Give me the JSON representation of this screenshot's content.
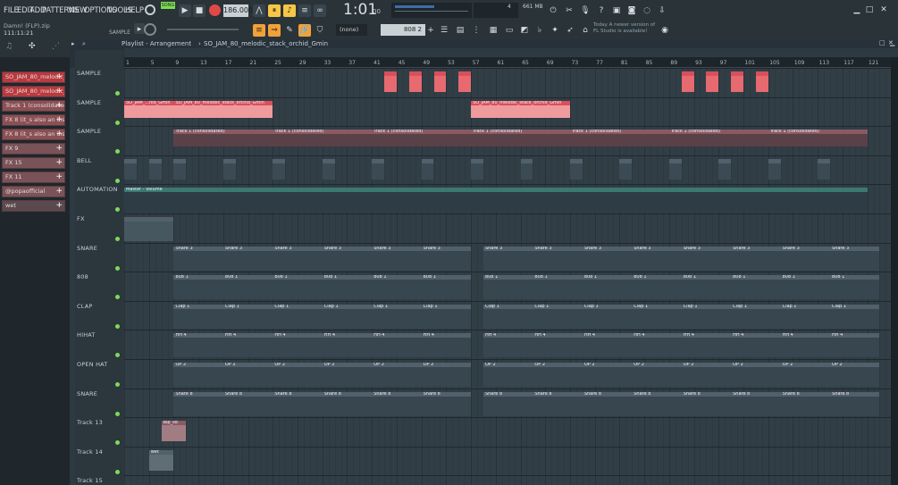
{
  "menu": {
    "items": [
      "FILE",
      "EDIT",
      "ADD",
      "PATTERNS",
      "VIEW",
      "OPTIONS",
      "TOOLS",
      "HELP"
    ]
  },
  "transport": {
    "song_label": "SONG",
    "tempo": "186.000",
    "time": "1:01",
    "time_sub": "00",
    "mem": "661 MB",
    "cpu": "4"
  },
  "project": {
    "name": "Damn! (FLP).zip",
    "time": "111:11:21",
    "sample_label": "SAMPLE"
  },
  "toolbar": {
    "snap": "(none)",
    "pattern": "808 2",
    "news": "Today  A newer version of FL Studio is available!"
  },
  "playlist": {
    "title": "Playlist - Arrangement",
    "breadcrumb": "SO_JAM_80_melodic_stack_orchid_Gmin"
  },
  "picker": [
    "SO_JAM_80_melodic_...",
    "SO_JAM_80_melodic_...",
    "Track 1 (consolidated)",
    "FX 8 (it_s also an ins...",
    "FX 8 (it_s also an ins...",
    "FX 9",
    "FX 15",
    "FX 11",
    "@popaofficial",
    "wet"
  ],
  "tracks": [
    "SAMPLE",
    "SAMPLE",
    "SAMPLE",
    "BELL",
    "AUTOMATION",
    "FX",
    "SNARE",
    "808",
    "CLAP",
    "HIHAT",
    "OPEN HAT",
    "SNARE",
    "Track 13",
    "Track 14",
    "Track 15"
  ],
  "ruler": [
    "1",
    "5",
    "9",
    "13",
    "17",
    "21",
    "25",
    "29",
    "33",
    "37",
    "41",
    "45",
    "49",
    "53",
    "57",
    "61",
    "65",
    "69",
    "73",
    "77",
    "81",
    "85",
    "89",
    "93",
    "97",
    "101",
    "105",
    "109",
    "113",
    "117",
    "121"
  ],
  "clip_labels": {
    "sample2a": "SO_JAM_...hid_Gmin",
    "sample2b": "SO_JAM_80_melodic_stack_orchid_Gmin",
    "sample2c": "SO_JAM_80_melodic_stack_orchid_Gmin",
    "track1": "Track 1 (consolidated)",
    "automation": "Master - Volume",
    "snare": "Snare 3",
    "b808": "808 1",
    "b808b": "808 2",
    "clap": "Clap 1",
    "hihat": "HH 4",
    "ohat": "OP 2",
    "snare2": "Snare 8",
    "t13": "Blp_sd",
    "t14": "wet"
  },
  "colors": {
    "accent": "#f2a13a",
    "red_clip": "#d8505b",
    "pink_wave": "#f2a7a9",
    "slate_clip": "#51606a",
    "auto": "#3a7872"
  }
}
